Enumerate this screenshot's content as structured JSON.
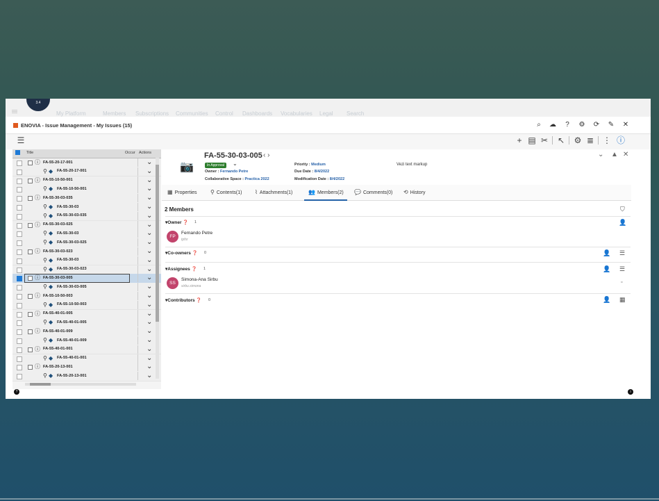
{
  "topnav": {
    "logo_text": "3.4",
    "items": [
      "My Platform",
      "Members",
      "Subscriptions",
      "Communities",
      "Control",
      "Dashboards",
      "Vocabularies",
      "Legal",
      "Search"
    ]
  },
  "window": {
    "title": "ENOVIA - Issue Management - My Issues (15)"
  },
  "tree": {
    "columns": {
      "title": "Title",
      "occur": "Occur",
      "actions": "Actions"
    },
    "rows": [
      {
        "label": "FA-55-20-17-001",
        "level": 0
      },
      {
        "label": "FA-55-20-17-001",
        "level": 1
      },
      {
        "label": "FA-55-10-50-001",
        "level": 0
      },
      {
        "label": "FA-55-10-50-001",
        "level": 1
      },
      {
        "label": "FA-55-30-03-035",
        "level": 0
      },
      {
        "label": "FA-55-30-03",
        "level": 1
      },
      {
        "label": "FA-55-30-03-035",
        "level": 1
      },
      {
        "label": "FA-55-30-03-025",
        "level": 0
      },
      {
        "label": "FA-55-30-03",
        "level": 1
      },
      {
        "label": "FA-55-30-03-025",
        "level": 1
      },
      {
        "label": "FA-55-30-03-023",
        "level": 0
      },
      {
        "label": "FA-55-30-03",
        "level": 1
      },
      {
        "label": "FA-55-30-03-023",
        "level": 1
      },
      {
        "label": "FA-55-30-03-005",
        "level": 0
      },
      {
        "label": "FA-55-30-03-005",
        "level": 1
      },
      {
        "label": "FA-55-10-50-003",
        "level": 0
      },
      {
        "label": "FA-55-10-50-003",
        "level": 1
      },
      {
        "label": "FA-55-40-01-005",
        "level": 0
      },
      {
        "label": "FA-55-40-01-005",
        "level": 1
      },
      {
        "label": "FA-55-40-01-009",
        "level": 0
      },
      {
        "label": "FA-55-40-01-009",
        "level": 1
      },
      {
        "label": "FA-55-40-01-001",
        "level": 0
      },
      {
        "label": "FA-55-40-01-001",
        "level": 1
      },
      {
        "label": "FA-55-20-13-001",
        "level": 0
      },
      {
        "label": "FA-55-20-13-001",
        "level": 1
      }
    ],
    "selected_index": 13
  },
  "detail": {
    "title": "FA-55-30-03-005",
    "state": "In Approval",
    "owner_label": "Owner :",
    "owner": "Fernando Petre",
    "collab_label": "Collaborative Space :",
    "collab": "Practica 2022",
    "priority_label": "Priority :",
    "priority": "Medium",
    "due_label": "Due Date :",
    "due": "8/4/2022",
    "mod_label": "Modification Date :",
    "mod": "8/4/2022",
    "note": "Vezi text markup"
  },
  "tabs": [
    "Properties",
    "Contents(1)",
    "Attachments(1)",
    "Members(2)",
    "Comments(0)",
    "History"
  ],
  "members": {
    "heading": "2 Members",
    "owner": {
      "label": "Owner",
      "count": "1",
      "user": {
        "initials": "FP",
        "name": "Fernando Petre",
        "login": "tpfsr"
      }
    },
    "coowners": {
      "label": "Co-owners",
      "count": "0"
    },
    "assignees": {
      "label": "Assignees",
      "count": "1",
      "user": {
        "initials": "SS",
        "name": "Simona-Ana Sirbu",
        "login": "sirbu.simona"
      }
    },
    "contributors": {
      "label": "Contributors",
      "count": "0"
    }
  },
  "colors": {
    "accent": "#2563a8",
    "state": "#2d7d2d",
    "owner_avatar": "#c2446c",
    "assignee_avatar": "#c2446c"
  }
}
